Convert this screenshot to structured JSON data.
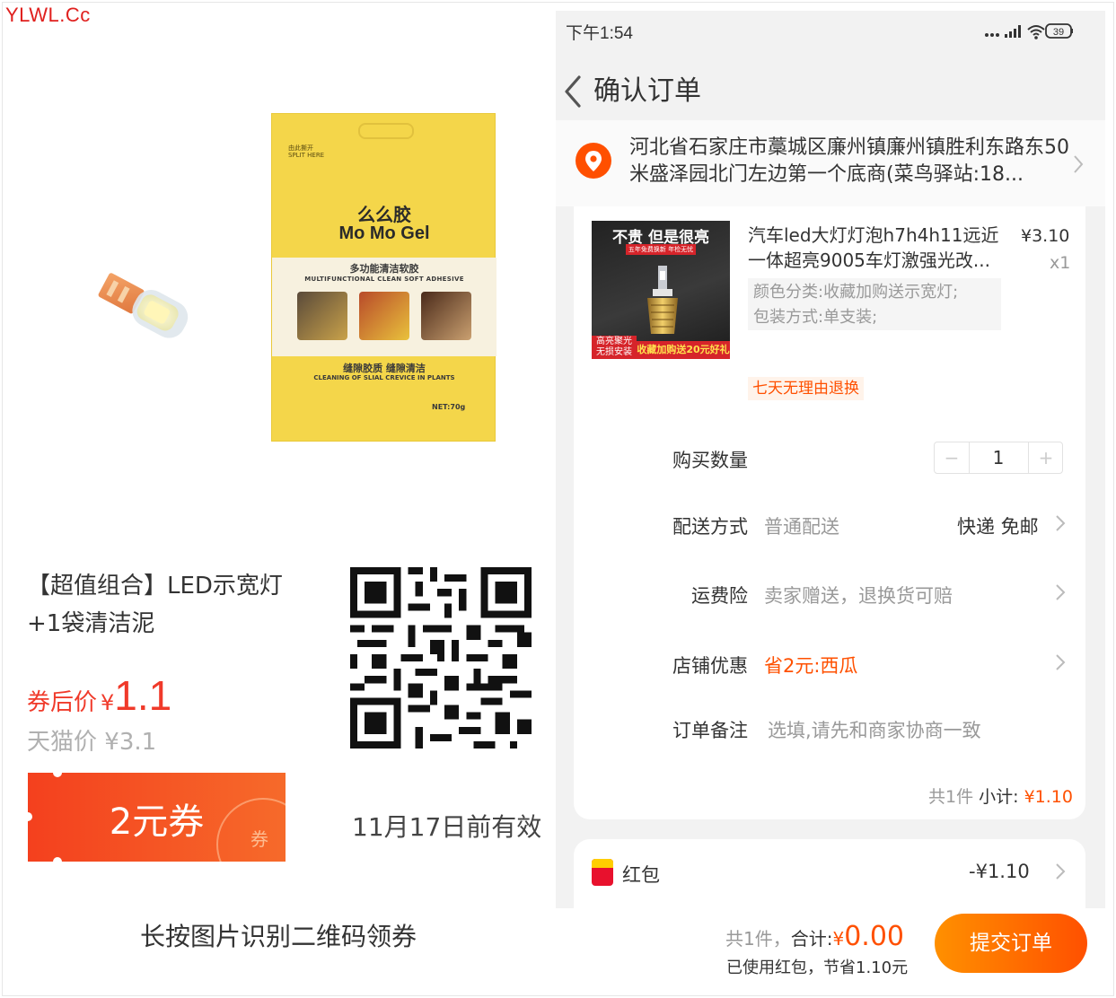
{
  "watermark": "YLWL.Cc",
  "promo": {
    "bag": {
      "split_hint": "由此撕开\nSPLIT HERE",
      "brand_cn": "么么胶",
      "brand_en": "Mo Mo Gel",
      "tag_cn": "多功能清洁软胶",
      "tag_en": "MULTIFUNCTIONAL CLEAN SOFT ADHESIVE",
      "sub_cn": "缝隙胶质   缝隙清洁",
      "sub_en": "CLEANING OF SLIAL CREVICE IN PLANTS",
      "net": "NET:70g"
    },
    "title": "【超值组合】LED示宽灯+1袋清洁泥",
    "after_label": "券后价",
    "currency": "¥",
    "after_value": "1.1",
    "tmall_label": "天猫价",
    "tmall_price": "¥3.1",
    "coupon_text": "2元券",
    "coupon_tag": "券",
    "valid_until": "11月17日前有效",
    "scan_hint": "长按图片识别二维码领券"
  },
  "phone": {
    "status": {
      "time": "下午1:54",
      "battery": "39"
    },
    "nav": {
      "title": "确认订单",
      "back_icon": "chevron-left-icon"
    },
    "address": "河北省石家庄市藁城区廉州镇廉州镇胜利东路东50米盛泽园北门左边第一个底商(菜鸟驿站:18...",
    "product": {
      "image_headline": "不贵 但是很亮",
      "image_sub": "五年免费换新  年检无忧",
      "image_left_footer": "高亮聚光\n无损安装",
      "image_right_footer": "收藏加购送20元好礼",
      "name": "汽车led大灯灯泡h7h4h11远近一体超亮9005车灯激强光改...",
      "price": "¥3.10",
      "qty": "x1",
      "sku_color": "颜色分类:收藏加购送示宽灯;",
      "sku_pack": "包装方式:单支装;",
      "tag": "七天无理由退换"
    },
    "rows": {
      "qty_label": "购买数量",
      "qty_value": "1",
      "qty_minus": "−",
      "qty_plus": "+",
      "delivery_label": "配送方式",
      "delivery_value": "普通配送",
      "delivery_right": "快递 免邮",
      "insurance_label": "运费险",
      "insurance_value": "卖家赠送，退换货可赔",
      "shop_label": "店铺优惠",
      "shop_value": "省2元:西瓜",
      "note_label": "订单备注",
      "note_placeholder": "选填,请先和商家协商一致"
    },
    "subtotal": {
      "count": "共1件",
      "label": "小计:",
      "amount": "¥1.10"
    },
    "redpacket": {
      "label": "红包",
      "amount": "-¥1.10"
    },
    "footer": {
      "count": "共1件，",
      "total_label": "合计:",
      "currency": "¥",
      "total_value": "0.00",
      "saved": "已使用红包，节省1.10元",
      "submit": "提交订单"
    }
  },
  "colors": {
    "accent": "#ff5000",
    "price_red": "#f03a2a",
    "bag_yellow": "#f4d64a"
  }
}
